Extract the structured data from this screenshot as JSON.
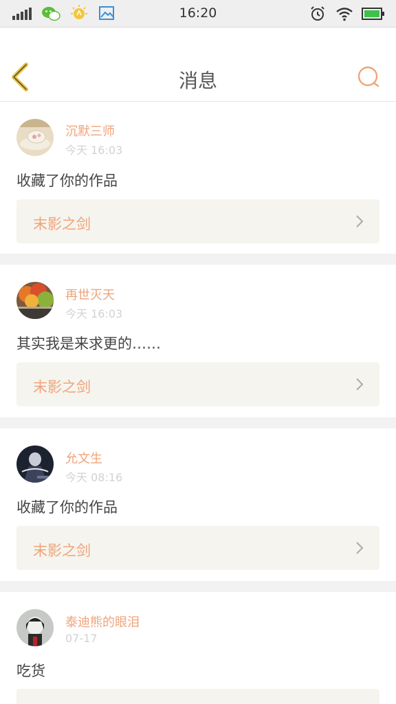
{
  "status_bar": {
    "time": "16:20",
    "icons": [
      "signal-icon",
      "wechat-icon",
      "bulb-icon",
      "gallery-icon",
      "alarm-icon",
      "wifi-icon",
      "battery-icon"
    ]
  },
  "header": {
    "title": "消息",
    "back_icon": "chevron-left-icon",
    "search_icon": "search-icon"
  },
  "colors": {
    "accent": "#f0a37a",
    "back_arrow": "#e8c23a",
    "card_bg": "#f5f4ee",
    "divider": "#f2f2f2"
  },
  "messages": [
    {
      "user": "沉默三师",
      "time": "今天 16:03",
      "text": "收藏了你的作品",
      "work": "末影之剑"
    },
    {
      "user": "再世灭天",
      "time": "今天 16:03",
      "text": "其实我是来求更的……",
      "work": "末影之剑"
    },
    {
      "user": "允文生",
      "time": "今天 08:16",
      "text": "收藏了你的作品",
      "work": "末影之剑"
    },
    {
      "user": "泰迪熊的眼泪",
      "time": "07-17",
      "text": "吃货",
      "work": ""
    }
  ]
}
